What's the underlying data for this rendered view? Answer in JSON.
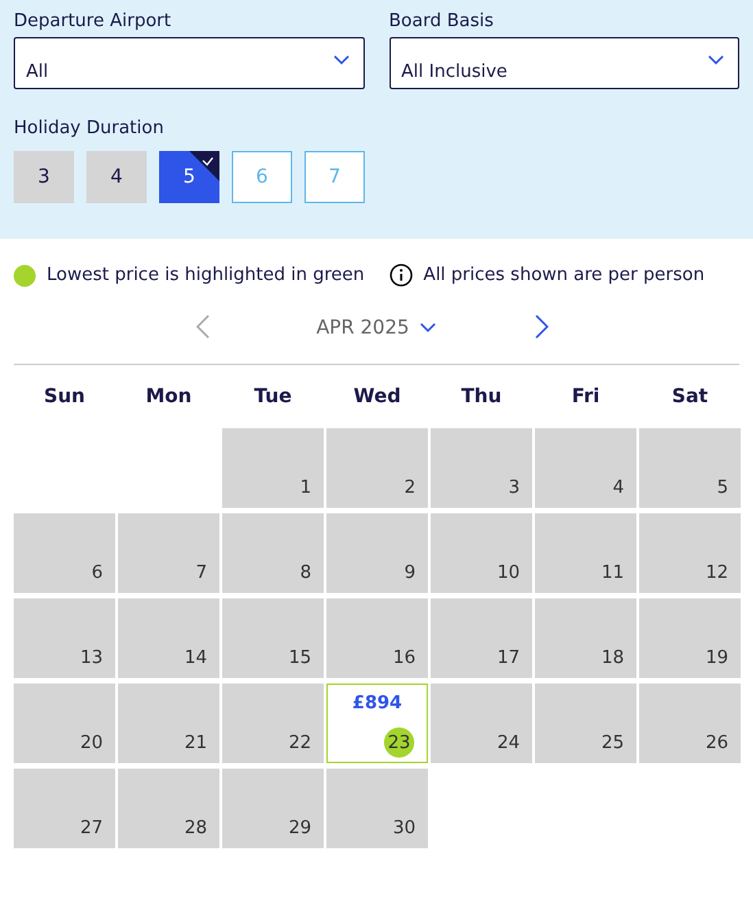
{
  "filters": {
    "departure": {
      "label": "Departure Airport",
      "value": "All"
    },
    "board": {
      "label": "Board Basis",
      "value": "All Inclusive"
    }
  },
  "duration": {
    "label": "Holiday Duration",
    "options": [
      {
        "label": "3",
        "kind": "unavailable",
        "selected": false
      },
      {
        "label": "4",
        "kind": "unavailable",
        "selected": false
      },
      {
        "label": "5",
        "kind": "available",
        "selected": true
      },
      {
        "label": "6",
        "kind": "available",
        "selected": false
      },
      {
        "label": "7",
        "kind": "available",
        "selected": false
      }
    ]
  },
  "legend": {
    "lowest": "Lowest price is highlighted in green",
    "info": "All prices shown are per person"
  },
  "calendar": {
    "month": "APR 2025",
    "prev_disabled": true,
    "weekdays": [
      "Sun",
      "Mon",
      "Tue",
      "Wed",
      "Thu",
      "Fri",
      "Sat"
    ],
    "weeks": [
      [
        {
          "kind": "empty"
        },
        {
          "kind": "empty"
        },
        {
          "kind": "unavailable",
          "day": "1"
        },
        {
          "kind": "unavailable",
          "day": "2"
        },
        {
          "kind": "unavailable",
          "day": "3"
        },
        {
          "kind": "unavailable",
          "day": "4"
        },
        {
          "kind": "unavailable",
          "day": "5"
        }
      ],
      [
        {
          "kind": "unavailable",
          "day": "6"
        },
        {
          "kind": "unavailable",
          "day": "7"
        },
        {
          "kind": "unavailable",
          "day": "8"
        },
        {
          "kind": "unavailable",
          "day": "9"
        },
        {
          "kind": "unavailable",
          "day": "10"
        },
        {
          "kind": "unavailable",
          "day": "11"
        },
        {
          "kind": "unavailable",
          "day": "12"
        }
      ],
      [
        {
          "kind": "unavailable",
          "day": "13"
        },
        {
          "kind": "unavailable",
          "day": "14"
        },
        {
          "kind": "unavailable",
          "day": "15"
        },
        {
          "kind": "unavailable",
          "day": "16"
        },
        {
          "kind": "unavailable",
          "day": "17"
        },
        {
          "kind": "unavailable",
          "day": "18"
        },
        {
          "kind": "unavailable",
          "day": "19"
        }
      ],
      [
        {
          "kind": "unavailable",
          "day": "20"
        },
        {
          "kind": "unavailable",
          "day": "21"
        },
        {
          "kind": "unavailable",
          "day": "22"
        },
        {
          "kind": "priced",
          "day": "23",
          "price": "£894",
          "lowest": true
        },
        {
          "kind": "unavailable",
          "day": "24"
        },
        {
          "kind": "unavailable",
          "day": "25"
        },
        {
          "kind": "unavailable",
          "day": "26"
        }
      ],
      [
        {
          "kind": "unavailable",
          "day": "27"
        },
        {
          "kind": "unavailable",
          "day": "28"
        },
        {
          "kind": "unavailable",
          "day": "29"
        },
        {
          "kind": "unavailable",
          "day": "30"
        }
      ]
    ]
  }
}
